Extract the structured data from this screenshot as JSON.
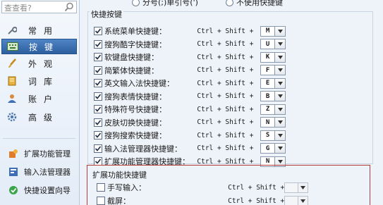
{
  "search": {
    "placeholder": "查查看?"
  },
  "top_options": {
    "option_a": "分号(;)单引号(')",
    "option_b": "不使用快捷键"
  },
  "nav": [
    {
      "label": "常用",
      "icon": "wrench-icon"
    },
    {
      "label": "按键",
      "icon": "keyboard-icon",
      "active": true
    },
    {
      "label": "外观",
      "icon": "brush-icon"
    },
    {
      "label": "词库",
      "icon": "book-icon"
    },
    {
      "label": "账户",
      "icon": "user-icon"
    },
    {
      "label": "高级",
      "icon": "gear-icon"
    }
  ],
  "tools": [
    {
      "label": "扩展功能管理",
      "icon": "extension-icon"
    },
    {
      "label": "输入法管理器",
      "icon": "manager-icon"
    },
    {
      "label": "快捷设置向导",
      "icon": "wizard-icon"
    }
  ],
  "shortcut_group": {
    "title": "快捷按键",
    "rows": [
      {
        "label": "系统菜单快捷键：",
        "combo": "Ctrl + Shift +",
        "key": "M",
        "checked": true
      },
      {
        "label": "搜狗酷字快捷键：",
        "combo": "Ctrl + Shift +",
        "key": "U",
        "checked": true
      },
      {
        "label": "软键盘快捷键：",
        "combo": "Ctrl + Shift +",
        "key": "K",
        "checked": true
      },
      {
        "label": "简繁体快捷键：",
        "combo": "Ctrl + Shift +",
        "key": "F",
        "checked": true
      },
      {
        "label": "英文输入法快捷键：",
        "combo": "Ctrl + Shift +",
        "key": "E",
        "checked": true
      },
      {
        "label": "搜狗表情快捷键：",
        "combo": "Ctrl + Shift +",
        "key": "B",
        "checked": true
      },
      {
        "label": "特殊符号快捷键：",
        "combo": "Ctrl + Shift +",
        "key": "Z",
        "checked": true
      },
      {
        "label": "皮肤切换快捷键：",
        "combo": "Ctrl + Shift +",
        "key": "N",
        "checked": true
      },
      {
        "label": "搜狗搜索快捷键：",
        "combo": "Ctrl + Shift +",
        "key": "S",
        "checked": true
      },
      {
        "label": "输入法管理器快捷键：",
        "combo": "Ctrl + Shift +",
        "key": "G",
        "checked": true
      },
      {
        "label": "扩展功能管理器快捷键：",
        "combo": "Ctrl + Shift +",
        "key": "N",
        "checked": true
      }
    ]
  },
  "extension_group": {
    "title": "扩展功能快捷键",
    "rows": [
      {
        "label": "手写输入：",
        "combo": "Ctrl + Shift +",
        "key": "",
        "checked": false
      },
      {
        "label": "截屏：",
        "combo": "Ctrl + Shift +",
        "key": "",
        "checked": false
      }
    ]
  },
  "colors": {
    "active_nav": "#3a6db0",
    "highlight_border": "#b53b3b"
  }
}
